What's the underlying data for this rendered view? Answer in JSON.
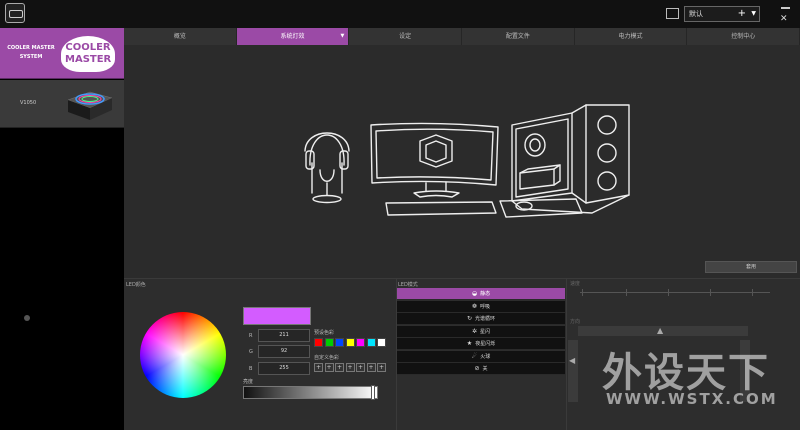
{
  "profile": {
    "name": "默认"
  },
  "devices": [
    {
      "label": "COOLER MASTER SYSTEM",
      "logo_text": [
        "COOLER",
        "MASTER"
      ],
      "selected": true
    },
    {
      "label": "V1050",
      "selected": false
    }
  ],
  "tabs": [
    {
      "label": "概览",
      "active": false
    },
    {
      "label": "系统灯效",
      "active": true
    },
    {
      "label": "设定",
      "active": false
    },
    {
      "label": "配置文件",
      "active": false
    },
    {
      "label": "电力模式",
      "active": false
    },
    {
      "label": "控制中心",
      "active": false
    }
  ],
  "apply_label": "套用",
  "led_color": {
    "title": "LED颜色",
    "current_color": "#d35cff",
    "r_label": "R",
    "g_label": "G",
    "b_label": "B",
    "r": "211",
    "g": "92",
    "b": "255",
    "preset_label": "预设色彩",
    "presets": [
      "#ff0000",
      "#00cc00",
      "#0044ff",
      "#ffff00",
      "#ff00ff",
      "#00e5ff",
      "#ffffff"
    ],
    "custom_label": "自定义色彩",
    "custom_slots": [
      "+",
      "+",
      "+",
      "+",
      "+",
      "+",
      "+"
    ],
    "brightness_label": "亮度",
    "brightness": 0.98
  },
  "led_mode": {
    "title": "LED模式",
    "modes": [
      {
        "label": "静态",
        "icon": "static-icon",
        "active": true
      },
      {
        "label": "呼吸",
        "icon": "breathing-icon",
        "active": false
      },
      {
        "label": "光谱循环",
        "icon": "cycle-icon",
        "active": false
      },
      {
        "label": "星闪",
        "icon": "star-burst-icon",
        "active": false
      },
      {
        "label": "夜星闪烁",
        "icon": "star-icon",
        "active": false
      },
      {
        "label": "火球",
        "icon": "fireball-icon",
        "active": false
      },
      {
        "label": "关",
        "icon": "off-icon",
        "active": false
      }
    ]
  },
  "mode_settings": {
    "speed_label": "速度",
    "direction_label": "方向"
  },
  "watermark": {
    "line1": "外设天下",
    "line2": "WWW.WSTX.COM"
  }
}
